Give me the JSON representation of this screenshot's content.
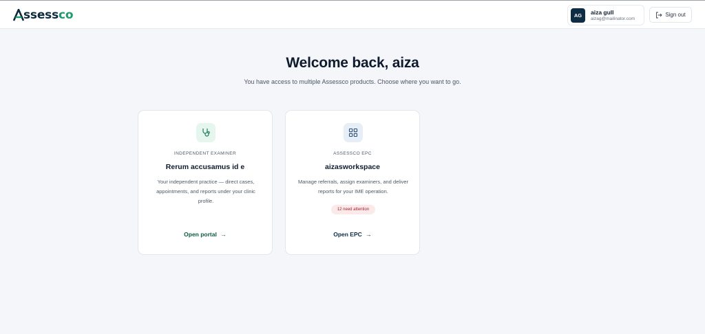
{
  "brand": {
    "name_dark": "ssess",
    "name_green": "co",
    "logo_icon": "assessco-a-mark"
  },
  "header": {
    "user": {
      "initials": "AG",
      "name": "aiza gull",
      "email": "aizag@mailinator.com"
    },
    "signout_label": "Sign out",
    "signout_icon": "sign-out-icon"
  },
  "main": {
    "title": "Welcome back, aiza",
    "subtitle": "You have access to multiple Assessco products. Choose where you want to go.",
    "cards": [
      {
        "icon": "stethoscope-icon",
        "kicker": "INDEPENDENT EXAMINER",
        "title": "Rerum accusamus id e",
        "description": "Your independent practice — direct cases, appointments, and reports under your clinic profile.",
        "link_label": "Open portal",
        "link_arrow": "→"
      },
      {
        "icon": "grid-icon",
        "kicker": "ASSESSCO EPC",
        "title": "aizasworkspace",
        "description": "Manage referrals, assign examiners, and deliver reports for your IME operation.",
        "badge": "12 need attention",
        "link_label": "Open EPC",
        "link_arrow": "→"
      }
    ]
  },
  "colors": {
    "brand_dark": "#0b2a3c",
    "brand_green": "#1f9a6d",
    "background": "#f4f6fa",
    "badge_bg": "#fce9ea",
    "badge_text": "#9b2430"
  }
}
